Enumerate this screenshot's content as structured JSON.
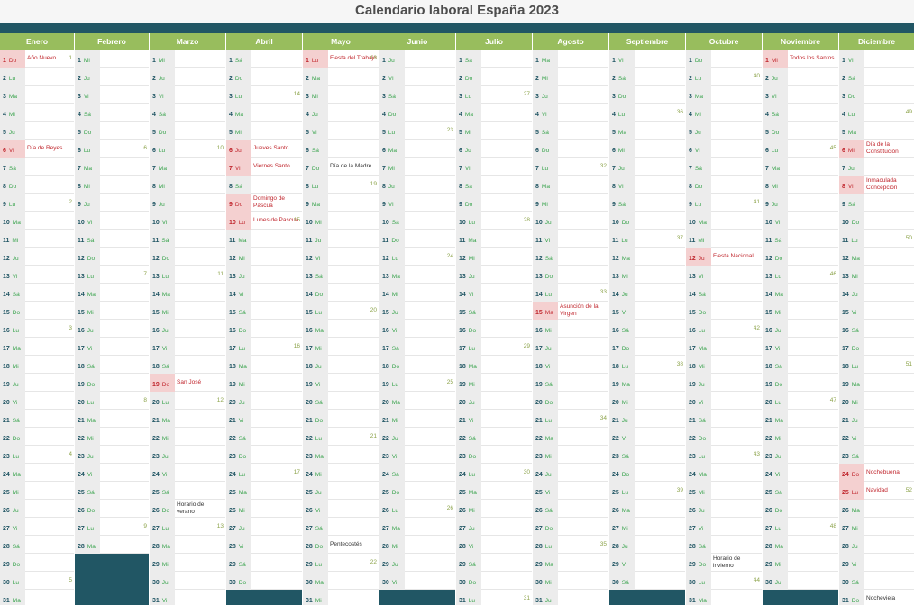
{
  "page": {
    "title": "Calendario laboral España 2023",
    "colors": {
      "header": "#98bd5d",
      "bar": "#215664",
      "holiday": "#c0262d",
      "weekday": "#38a34c"
    }
  },
  "months": [
    {
      "name": "Enero",
      "start": "Do",
      "days": 31,
      "events": {
        "1": {
          "text": "Año Nuevo",
          "hol": true
        },
        "6": {
          "text": "Día de Reyes",
          "hol": true
        }
      },
      "weeks": {
        "1": "1",
        "9": "2",
        "16": "3",
        "23": "4",
        "30": "5"
      }
    },
    {
      "name": "Febrero",
      "start": "Mi",
      "days": 28,
      "events": {},
      "weeks": {
        "6": "6",
        "13": "7",
        "20": "8",
        "27": "9"
      }
    },
    {
      "name": "Marzo",
      "start": "Mi",
      "days": 31,
      "events": {
        "19": {
          "text": "San José",
          "hol": true
        },
        "26": {
          "text": "Horario de verano",
          "hol": false
        }
      },
      "weeks": {
        "6": "10",
        "13": "11",
        "20": "12",
        "27": "13"
      }
    },
    {
      "name": "Abril",
      "start": "Sá",
      "days": 30,
      "events": {
        "6": {
          "text": "Jueves Santo",
          "hol": true
        },
        "7": {
          "text": "Viernes Santo",
          "hol": true
        },
        "9": {
          "text": "Domingo de Pascua",
          "hol": true
        },
        "10": {
          "text": "Lunes de Pascua",
          "hol": true
        }
      },
      "weeks": {
        "3": "14",
        "10": "15",
        "17": "16",
        "24": "17"
      }
    },
    {
      "name": "Mayo",
      "start": "Lu",
      "days": 31,
      "events": {
        "1": {
          "text": "Fiesta del Trabajo",
          "hol": true
        },
        "7": {
          "text": "Día de la Madre",
          "hol": false
        },
        "28": {
          "text": "Pentecostés",
          "hol": false
        }
      },
      "weeks": {
        "1": "18",
        "8": "19",
        "15": "20",
        "22": "21",
        "29": "22"
      }
    },
    {
      "name": "Junio",
      "start": "Ju",
      "days": 30,
      "events": {},
      "weeks": {
        "5": "23",
        "12": "24",
        "19": "25",
        "26": "26"
      }
    },
    {
      "name": "Julio",
      "start": "Sá",
      "days": 31,
      "events": {},
      "weeks": {
        "3": "27",
        "10": "28",
        "17": "29",
        "24": "30",
        "31": "31"
      }
    },
    {
      "name": "Agosto",
      "start": "Ma",
      "days": 31,
      "events": {
        "15": {
          "text": "Asunción de la Virgen",
          "hol": true
        }
      },
      "weeks": {
        "7": "32",
        "14": "33",
        "21": "34",
        "28": "35"
      }
    },
    {
      "name": "Septiembre",
      "start": "Vi",
      "days": 30,
      "events": {},
      "weeks": {
        "4": "36",
        "11": "37",
        "18": "38",
        "25": "39"
      }
    },
    {
      "name": "Octubre",
      "start": "Do",
      "days": 31,
      "events": {
        "12": {
          "text": "Fiesta Nacional",
          "hol": true
        },
        "29": {
          "text": "Horario de invierno",
          "hol": false
        }
      },
      "weeks": {
        "2": "40",
        "9": "41",
        "16": "42",
        "23": "43",
        "30": "44"
      }
    },
    {
      "name": "Noviembre",
      "start": "Mi",
      "days": 30,
      "events": {
        "1": {
          "text": "Todos los Santos",
          "hol": true
        }
      },
      "weeks": {
        "6": "45",
        "13": "46",
        "20": "47",
        "27": "48"
      }
    },
    {
      "name": "Diciembre",
      "start": "Vi",
      "days": 31,
      "events": {
        "6": {
          "text": "Día de la Constitución",
          "hol": true
        },
        "8": {
          "text": "Inmaculada Concepción",
          "hol": true
        },
        "24": {
          "text": "Nochebuena",
          "hol": true
        },
        "25": {
          "text": "Navidad",
          "hol": true
        },
        "31": {
          "text": "Nochevieja",
          "hol": false
        }
      },
      "weeks": {
        "4": "49",
        "11": "50",
        "18": "51",
        "25": "52"
      }
    }
  ],
  "weekday_abbrevs": [
    "Lu",
    "Ma",
    "Mi",
    "Ju",
    "Vi",
    "Sá",
    "Do"
  ]
}
